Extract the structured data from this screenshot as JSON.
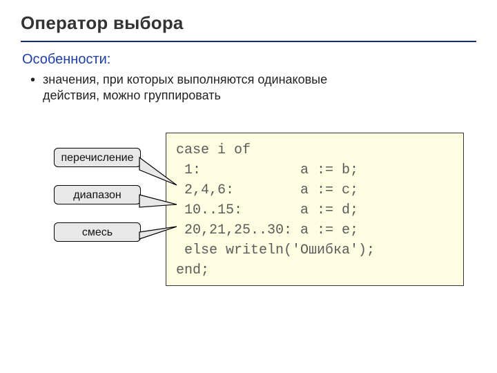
{
  "title": "Оператор выбора",
  "subtitle": "Особенности:",
  "bullet": "значения, при которых выполняются одинаковые\nдействия, можно группировать",
  "callouts": {
    "enumeration": "перечисление",
    "range": "диапазон",
    "mix": "смесь"
  },
  "code": {
    "l1": "case i of",
    "l2": " 1:            a := b;",
    "l3": " 2,4,6:        a := c;",
    "l4": " 10..15:       a := d;",
    "l5": " 20,21,25..30: a := e;",
    "l6": " else writeln('Ошибка');",
    "l7": "end;"
  }
}
